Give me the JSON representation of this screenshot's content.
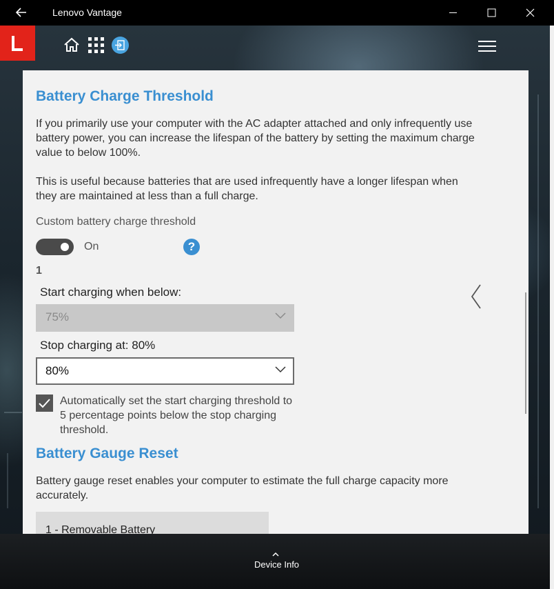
{
  "window": {
    "title": "Lenovo Vantage"
  },
  "nav": {
    "logo_letter": "L",
    "icons": [
      "home-icon",
      "apps-grid-icon",
      "sign-in-icon",
      "hamburger-menu-icon"
    ]
  },
  "battery_threshold": {
    "heading": "Battery Charge Threshold",
    "para1": "If you primarily use your computer with the AC adapter attached and only infrequently use battery power, you can increase the lifespan of the battery by setting the maximum charge value to below 100%.",
    "para2": "This is useful because batteries that are used infrequently have a longer lifespan when they are maintained at less than a full charge.",
    "custom_label": "Custom battery charge threshold",
    "toggle_state": "On",
    "toggle_on": true,
    "battery_number": "1",
    "start_label": "Start charging when below:",
    "start_value": "75%",
    "stop_label": "Stop charging at: 80%",
    "stop_value": "80%",
    "auto_checked": true,
    "auto_label": "Automatically set the start charging threshold to 5 percentage points below the stop charging threshold."
  },
  "gauge_reset": {
    "heading": "Battery Gauge Reset",
    "description": "Battery gauge reset enables your computer to estimate the full charge capacity more accurately.",
    "battery_item": "1 - Removable Battery"
  },
  "footer": {
    "device_info": "Device Info"
  },
  "colors": {
    "accent": "#3a8fd1",
    "logo_red": "#e2231a"
  }
}
